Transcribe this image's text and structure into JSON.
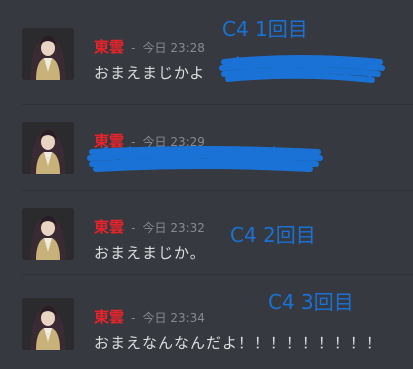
{
  "messages": [
    {
      "author": "東雲",
      "separator": "-",
      "time": "今日 23:28",
      "text": "おまえまじかよ",
      "annotation": "C4 1回目",
      "name_color": "#e8232c"
    },
    {
      "author": "東雲",
      "separator": "-",
      "time": "今日 23:29",
      "text": "",
      "annotation": "",
      "name_color": "#e8232c"
    },
    {
      "author": "東雲",
      "separator": "-",
      "time": "今日 23:32",
      "text": "おまえまじか。",
      "annotation": "C4 2回目",
      "name_color": "#e8232c"
    },
    {
      "author": "東雲",
      "separator": "-",
      "time": "今日 23:34",
      "text": "おまえなんなんだよ！！！！！！！！！",
      "annotation": "C4 3回目",
      "name_color": "#e8232c"
    }
  ],
  "colors": {
    "background": "#36393f",
    "annotation_ink": "#1a72d6"
  },
  "icons": {
    "avatar": "character-avatar-icon",
    "redaction": "scribble-redaction"
  }
}
